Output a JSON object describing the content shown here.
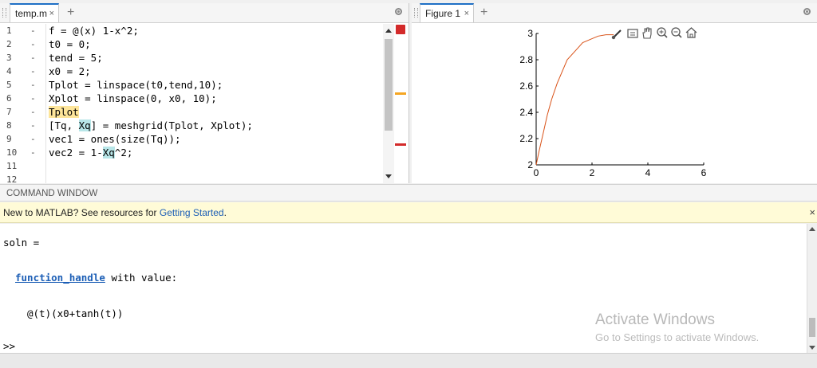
{
  "editor": {
    "tab_label": "temp.m",
    "tab_close": "×",
    "add_tab": "+",
    "line_numbers": [
      "1",
      "2",
      "3",
      "4",
      "5",
      "6",
      "7",
      "8",
      "9",
      "10",
      "11",
      "12"
    ],
    "line_marker": "-",
    "code": [
      "f = @(x) 1-x^2;",
      "t0 = 0;",
      "tend = 5;",
      "x0 = 2;",
      "Tplot = linspace(t0,tend,10);",
      "Xplot = linspace(0, x0, 10);",
      "Tplot",
      "[Tq, Xq] = meshgrid(Tplot, Xplot);",
      "vec1 = ones(size(Tq));",
      "vec2 = 1-Xq^2;"
    ],
    "line8": {
      "a": "[Tq, ",
      "b": "Xq",
      "c": "] = meshgrid(Tplot, Xplot);"
    },
    "line10": {
      "a": "vec2 = 1-",
      "b": "Xq",
      "c": "^2;"
    },
    "colors": {
      "status_error": "#d32a2a",
      "warning_marker": "#f5a623",
      "error_marker": "#d32a2a"
    }
  },
  "figure": {
    "tab_label": "Figure 1",
    "tab_close": "×",
    "add_tab": "+",
    "toolbar_icons": [
      "brush-icon",
      "save-icon",
      "pan-icon",
      "zoom-in-icon",
      "zoom-out-icon",
      "home-icon"
    ]
  },
  "chart_data": {
    "type": "line",
    "title": "",
    "xlabel": "",
    "ylabel": "",
    "xlim": [
      0,
      6
    ],
    "ylim": [
      2,
      3
    ],
    "xticks": [
      0,
      2,
      4,
      6
    ],
    "yticks": [
      2,
      2.2,
      2.4,
      2.6,
      2.8,
      3
    ],
    "grid": false,
    "series": [
      {
        "color": "#d95319",
        "x": [
          0,
          0.1,
          0.25,
          0.4,
          0.556,
          0.75,
          1.111,
          1.5,
          1.667,
          2.0,
          2.222,
          2.5,
          2.778
        ],
        "y": [
          2,
          2.1,
          2.24,
          2.38,
          2.5,
          2.62,
          2.8,
          2.89,
          2.93,
          2.96,
          2.98,
          2.99,
          2.99
        ]
      }
    ]
  },
  "command": {
    "header": "COMMAND WINDOW",
    "notice_text": "New to MATLAB? See resources for ",
    "notice_link": "Getting Started",
    "notice_end": ".",
    "notice_close": "×",
    "output": {
      "soln_line": "soln =",
      "fh_label": "function_handle",
      "fh_suffix": " with value:",
      "value": "@(t)(x0+tanh(t))",
      "prompt": ">>"
    }
  },
  "watermark": {
    "line1": "Activate Windows",
    "line2": "Go to Settings to activate Windows."
  }
}
